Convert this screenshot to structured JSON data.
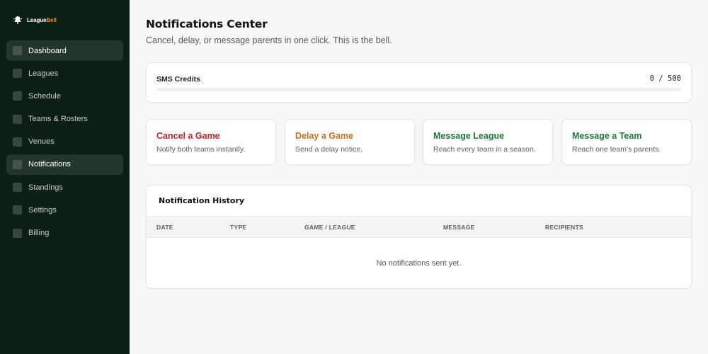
{
  "brand": {
    "name_part1": "League",
    "name_part2": "Bell"
  },
  "sidebar": {
    "items": [
      {
        "label": "Dashboard",
        "active": true
      },
      {
        "label": "Leagues"
      },
      {
        "label": "Schedule"
      },
      {
        "label": "Teams & Rosters"
      },
      {
        "label": "Venues"
      },
      {
        "label": "Notifications",
        "active": true
      },
      {
        "label": "Standings"
      },
      {
        "label": "Settings"
      },
      {
        "label": "Billing"
      }
    ]
  },
  "header": {
    "title": "Notifications Center",
    "subtitle": "Cancel, delay, or message parents in one click. This is the bell."
  },
  "sms": {
    "label": "SMS Credits",
    "count": "0 / 500",
    "progress_fraction": 0
  },
  "actions": [
    {
      "title": "Cancel a Game",
      "desc": "Notify both teams instantly.",
      "color": "#c8222b"
    },
    {
      "title": "Delay a Game",
      "desc": "Send a delay notice.",
      "color": "#c8711a"
    },
    {
      "title": "Message League",
      "desc": "Reach every team in a season.",
      "color": "#1f7a3a"
    },
    {
      "title": "Message a Team",
      "desc": "Reach one team's parents.",
      "color": "#1f7a3a"
    }
  ],
  "history": {
    "title": "Notification History",
    "columns": [
      "DATE",
      "TYPE",
      "GAME / LEAGUE",
      "MESSAGE",
      "RECIPIENTS"
    ],
    "empty": "No notifications sent yet."
  },
  "colors": {
    "sidebar_bg": "#0d1f14",
    "accent_orange": "#f08c1d",
    "brand_green": "#1f7a3a"
  }
}
